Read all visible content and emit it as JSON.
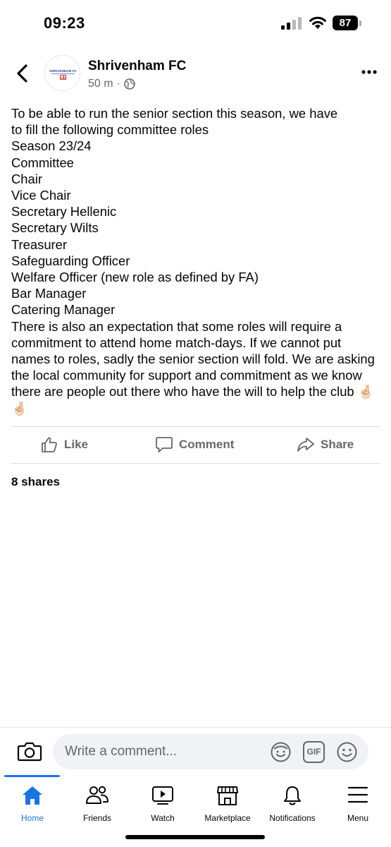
{
  "status_bar": {
    "time": "09:23",
    "battery": "87"
  },
  "post": {
    "page_name": "Shrivenham FC",
    "avatar_text": "SHRIVENHAM FC",
    "time_ago": "50 m",
    "separator": "·",
    "lines": [
      "To be able to run the senior section this season, we have",
      "to fill the following committee roles",
      "Season 23/24",
      "Committee",
      "Chair",
      "Vice Chair",
      "Secretary Hellenic",
      "Secretary Wilts",
      "Treasurer",
      "Safeguarding Officer",
      "Welfare Officer (new role as defined by FA)",
      "Bar Manager",
      "Catering Manager"
    ],
    "closing_paragraph": "There is also an expectation that some roles will require a commitment to attend home match-days. If we cannot put names to roles, sadly the senior section will fold. We are asking the local community for support and commitment as we know there are people out there who have the will to help the club",
    "closing_emoji": "🤞🏻 🤞🏻"
  },
  "actions": {
    "like": "Like",
    "comment": "Comment",
    "share": "Share"
  },
  "shares": "8 shares",
  "composer": {
    "placeholder": "Write a comment...",
    "gif": "GIF"
  },
  "nav": [
    {
      "label": "Home",
      "icon": "home-icon",
      "active": true
    },
    {
      "label": "Friends",
      "icon": "friends-icon"
    },
    {
      "label": "Watch",
      "icon": "watch-icon"
    },
    {
      "label": "Marketplace",
      "icon": "marketplace-icon"
    },
    {
      "label": "Notifications",
      "icon": "bell-icon"
    },
    {
      "label": "Menu",
      "icon": "menu-icon"
    }
  ],
  "colors": {
    "accent": "#1b74e4",
    "muted": "#65676b",
    "text": "#050505"
  }
}
